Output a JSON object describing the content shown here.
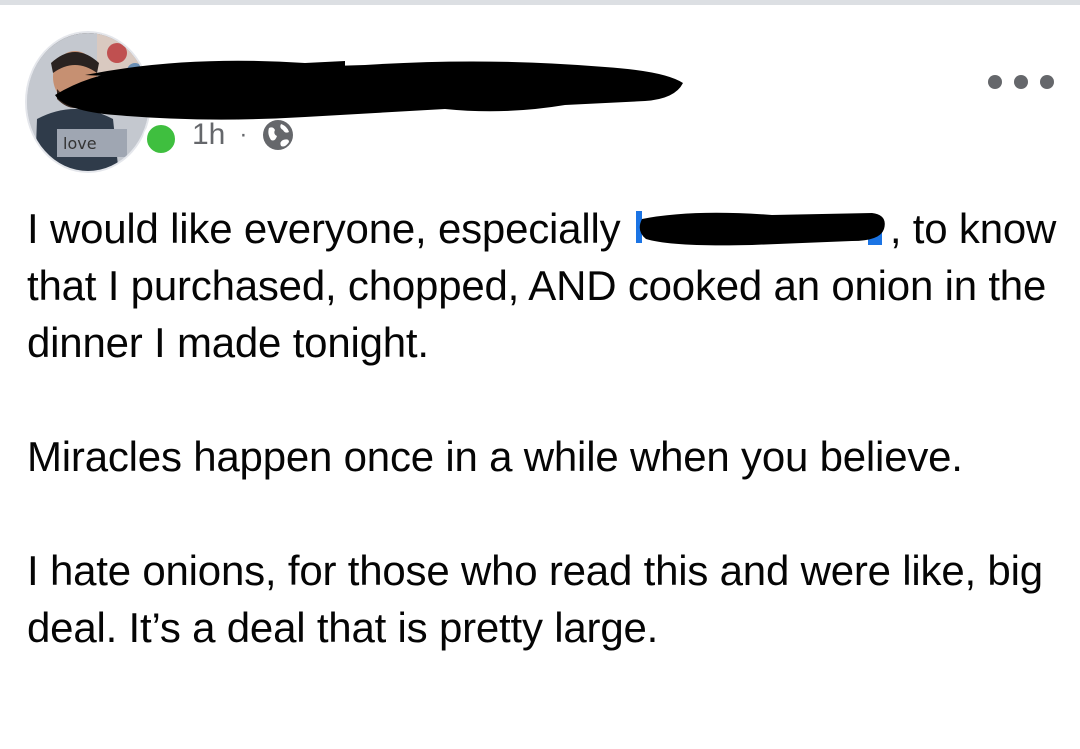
{
  "post": {
    "author_name_redacted": true,
    "timestamp": "1h",
    "separator": "·",
    "privacy_icon": "globe-icon",
    "more_icon": "more-options-icon",
    "mention_redacted": true,
    "paragraphs": [
      {
        "before_mention": "I would like everyone, especially ",
        "after_mention": ", to know that I purchased, chopped, AND cooked an onion in the dinner I made tonight."
      },
      {
        "text": "Miracles happen once in a while when you believe."
      },
      {
        "text": "I hate onions, for those who read this and were like, big deal. It’s a deal that is pretty large."
      }
    ]
  },
  "colors": {
    "online_status": "#3fbf3f",
    "mention_link": "#1b74e4",
    "meta_text": "#65676b",
    "redaction": "#000000"
  }
}
